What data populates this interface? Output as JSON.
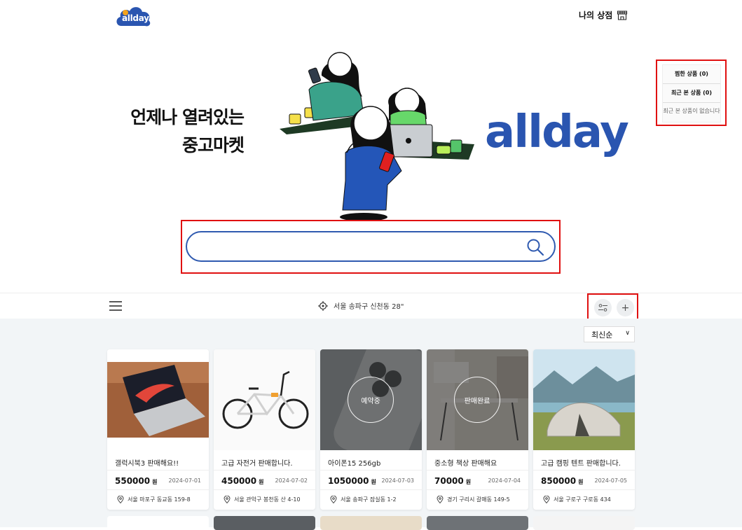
{
  "header": {
    "logo_text": "allday",
    "mystore_label": "나의 상점"
  },
  "hero": {
    "line1": "언제나 열려있는",
    "line2": "중고마켓",
    "brand": "allday"
  },
  "sidebox": {
    "liked": "찜한 상품 (0)",
    "recent": "최근 본 상품 (0)",
    "recent_empty": "최근 본 상품이 없습니다"
  },
  "search": {
    "value": "",
    "placeholder": ""
  },
  "toolbar": {
    "location": "서울 송파구 신천동 28\""
  },
  "sort": {
    "selected": "최신순"
  },
  "products": [
    {
      "title": "갤럭시북3 판매해요!!",
      "price": "550000",
      "currency": "원",
      "date": "2024-07-01",
      "address": "서울 마포구 동교동 159-8",
      "status": ""
    },
    {
      "title": "고급 자전거 판매합니다.",
      "price": "450000",
      "currency": "원",
      "date": "2024-07-02",
      "address": "서울 관악구 봉천동 산 4-10",
      "status": ""
    },
    {
      "title": "아이폰15 256gb",
      "price": "1050000",
      "currency": "원",
      "date": "2024-07-03",
      "address": "서울 송파구 잠실동 1-2",
      "status": "예약중"
    },
    {
      "title": "중소형 책상 판매해요",
      "price": "70000",
      "currency": "원",
      "date": "2024-07-04",
      "address": "경기 구리시 갈매동 149-5",
      "status": "판매완료"
    },
    {
      "title": "고급 캠핑 텐트 판매합니다.",
      "price": "850000",
      "currency": "원",
      "date": "2024-07-05",
      "address": "서울 구로구 구로동 434",
      "status": ""
    }
  ],
  "colors": {
    "brand": "#2a55b0",
    "highlight": "#e01010",
    "background": "#f2f5f7"
  }
}
